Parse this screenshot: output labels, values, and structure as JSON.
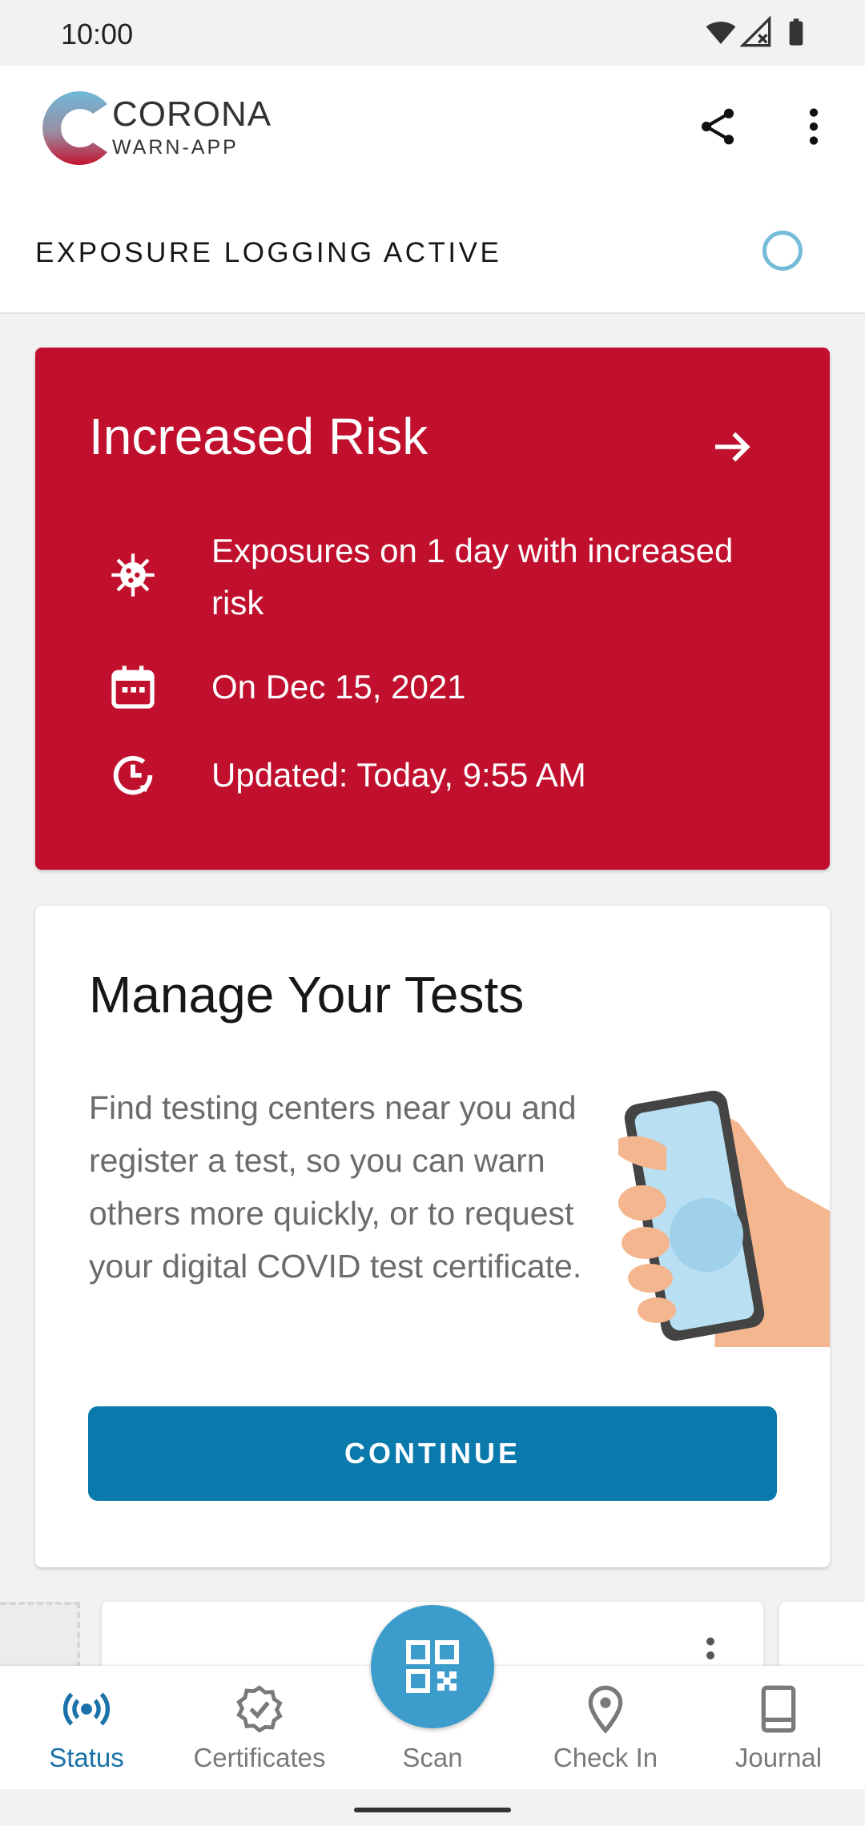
{
  "status_bar": {
    "time": "10:00"
  },
  "app_bar": {
    "logo_title": "CORONA",
    "logo_subtitle": "WARN-APP",
    "share_icon": "share-icon",
    "overflow_icon": "more-vert-icon"
  },
  "exposure": {
    "label": "EXPOSURE LOGGING ACTIVE"
  },
  "risk_card": {
    "title": "Increased Risk",
    "background_color": "#c1102e",
    "rows": [
      {
        "icon": "virus-icon",
        "text": "Exposures on 1 day with increased risk"
      },
      {
        "icon": "calendar-icon",
        "text": "On Dec 15, 2021"
      },
      {
        "icon": "clock-refresh-icon",
        "text": "Updated: Today, 9:55 AM"
      }
    ]
  },
  "tests_card": {
    "title": "Manage Your Tests",
    "body": "Find testing centers near you and register a test, so you can warn others more quickly, or to request your digital COVID test certificate.",
    "button_label": "CONTINUE",
    "button_color": "#0a7aac"
  },
  "bottom_nav": {
    "active_color": "#1a72a8",
    "items": [
      {
        "label": "Status",
        "icon": "broadcast-icon",
        "active": true
      },
      {
        "label": "Certificates",
        "icon": "badge-check-icon",
        "active": false
      },
      {
        "label": "Scan",
        "icon": "qr-code-icon",
        "active": false
      },
      {
        "label": "Check In",
        "icon": "location-pin-icon",
        "active": false
      },
      {
        "label": "Journal",
        "icon": "book-icon",
        "active": false
      }
    ]
  }
}
